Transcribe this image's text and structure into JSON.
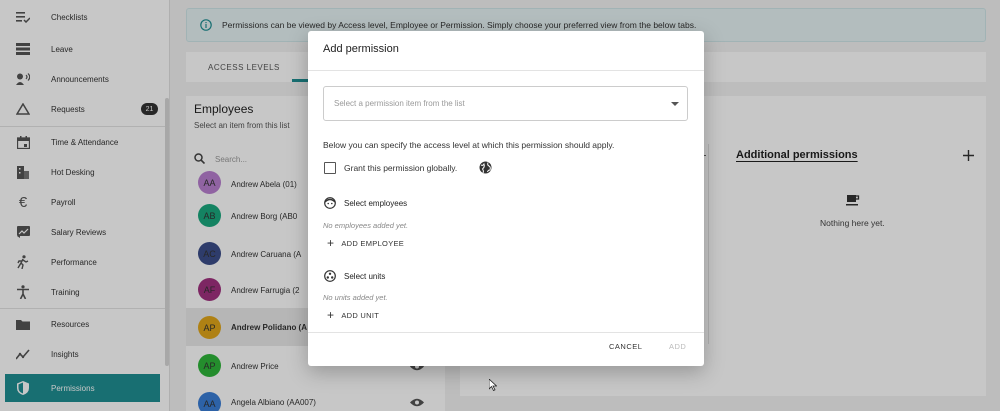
{
  "sidebar": {
    "items": [
      {
        "label": "Checklists",
        "icon": "checklist-icon"
      },
      {
        "label": "Leave",
        "icon": "leave-icon"
      },
      {
        "label": "Announcements",
        "icon": "megaphone-icon"
      },
      {
        "label": "Requests",
        "icon": "warning-triangle-icon",
        "badge": "21"
      },
      {
        "label": "Time & Attendance",
        "icon": "calendar-icon"
      },
      {
        "label": "Hot Desking",
        "icon": "building-icon"
      },
      {
        "label": "Payroll",
        "icon": "euro-icon"
      },
      {
        "label": "Salary Reviews",
        "icon": "chart-box-icon"
      },
      {
        "label": "Performance",
        "icon": "runner-icon"
      },
      {
        "label": "Training",
        "icon": "accessibility-icon"
      },
      {
        "label": "Resources",
        "icon": "folder-icon"
      },
      {
        "label": "Insights",
        "icon": "trend-icon"
      },
      {
        "label": "Permissions",
        "icon": "shield-icon"
      }
    ]
  },
  "banner": {
    "text": "Permissions can be viewed by Access level, Employee or Permission. Simply choose your preferred view from the below tabs."
  },
  "tabs": {
    "access_levels": "ACCESS LEVELS"
  },
  "employees": {
    "title": "Employees",
    "subtitle": "Select an item from this list",
    "search_placeholder": "Search...",
    "rows": [
      {
        "initials": "AA",
        "name": "Andrew Abela (01)",
        "color": "#b97fd0"
      },
      {
        "initials": "AB",
        "name": "Andrew Borg (AB0",
        "color": "#1aa87e"
      },
      {
        "initials": "AC",
        "name": "Andrew Caruana (A",
        "color": "#3b4d8a"
      },
      {
        "initials": "AF",
        "name": "Andrew Farrugia (2",
        "color": "#a0317f"
      },
      {
        "initials": "AP",
        "name": "Andrew Polidano (A",
        "color": "#e0a61a"
      },
      {
        "initials": "AP",
        "name": "Andrew Price",
        "color": "#2fb53a"
      },
      {
        "initials": "AA",
        "name": "Angela Albiano (AA007)",
        "color": "#3a7ed6"
      }
    ]
  },
  "additional_permissions": {
    "title": "Additional permissions",
    "empty_text": "Nothing here yet."
  },
  "modal": {
    "title": "Add permission",
    "select_placeholder": "Select a permission item from the list",
    "description": "Below you can specify the access level at which this permission should apply.",
    "grant_globally_label": "Grant this permission globally.",
    "select_employees_label": "Select employees",
    "no_employees_text": "No employees added yet.",
    "add_employee_label": "ADD EMPLOYEE",
    "select_units_label": "Select units",
    "no_units_text": "No units added yet.",
    "add_unit_label": "ADD UNIT",
    "cancel_label": "CANCEL",
    "add_label": "ADD"
  },
  "colors": {
    "accent": "#1f8f93",
    "banner_bg": "#e6f3f4"
  }
}
